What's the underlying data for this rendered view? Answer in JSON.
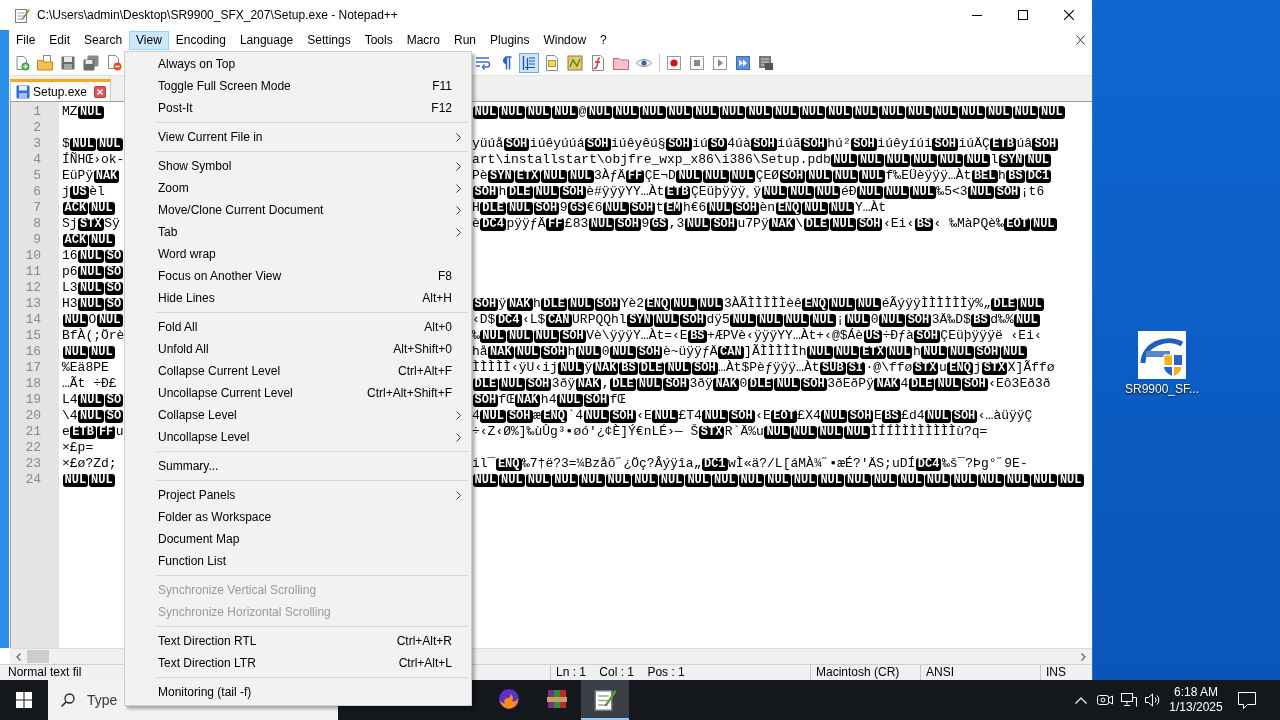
{
  "window": {
    "title": "C:\\Users\\admin\\Desktop\\SR9900_SFX_207\\Setup.exe - Notepad++"
  },
  "menus": [
    {
      "label": "File",
      "selected": false
    },
    {
      "label": "Edit",
      "selected": false
    },
    {
      "label": "Search",
      "selected": false
    },
    {
      "label": "View",
      "selected": true
    },
    {
      "label": "Encoding",
      "selected": false
    },
    {
      "label": "Language",
      "selected": false
    },
    {
      "label": "Settings",
      "selected": false
    },
    {
      "label": "Tools",
      "selected": false
    },
    {
      "label": "Macro",
      "selected": false
    },
    {
      "label": "Run",
      "selected": false
    },
    {
      "label": "Plugins",
      "selected": false
    },
    {
      "label": "Window",
      "selected": false
    },
    {
      "label": "?",
      "selected": false
    }
  ],
  "view_menu": [
    {
      "kind": "item",
      "label": "Always on Top",
      "submenu": false,
      "disabled": false
    },
    {
      "kind": "item",
      "label": "Toggle Full Screen Mode",
      "shortcut": "F11",
      "submenu": false,
      "disabled": false
    },
    {
      "kind": "item",
      "label": "Post-It",
      "shortcut": "F12",
      "submenu": false,
      "disabled": false
    },
    {
      "kind": "separator"
    },
    {
      "kind": "item",
      "label": "View Current File in",
      "submenu": true,
      "disabled": false
    },
    {
      "kind": "separator"
    },
    {
      "kind": "item",
      "label": "Show Symbol",
      "submenu": true,
      "disabled": false
    },
    {
      "kind": "item",
      "label": "Zoom",
      "submenu": true,
      "disabled": false
    },
    {
      "kind": "item",
      "label": "Move/Clone Current Document",
      "submenu": true,
      "disabled": false
    },
    {
      "kind": "item",
      "label": "Tab",
      "submenu": true,
      "disabled": false
    },
    {
      "kind": "item",
      "label": "Word wrap",
      "submenu": false,
      "disabled": false
    },
    {
      "kind": "item",
      "label": "Focus on Another View",
      "shortcut": "F8",
      "submenu": false,
      "disabled": false
    },
    {
      "kind": "item",
      "label": "Hide Lines",
      "shortcut": "Alt+H",
      "submenu": false,
      "disabled": false
    },
    {
      "kind": "separator"
    },
    {
      "kind": "item",
      "label": "Fold All",
      "shortcut": "Alt+0",
      "submenu": false,
      "disabled": false
    },
    {
      "kind": "item",
      "label": "Unfold All",
      "shortcut": "Alt+Shift+0",
      "submenu": false,
      "disabled": false
    },
    {
      "kind": "item",
      "label": "Collapse Current Level",
      "shortcut": "Ctrl+Alt+F",
      "submenu": false,
      "disabled": false
    },
    {
      "kind": "item",
      "label": "Uncollapse Current Level",
      "shortcut": "Ctrl+Alt+Shift+F",
      "submenu": false,
      "disabled": false
    },
    {
      "kind": "item",
      "label": "Collapse Level",
      "submenu": true,
      "disabled": false
    },
    {
      "kind": "item",
      "label": "Uncollapse Level",
      "submenu": true,
      "disabled": false
    },
    {
      "kind": "separator"
    },
    {
      "kind": "item",
      "label": "Summary...",
      "submenu": false,
      "disabled": false
    },
    {
      "kind": "separator"
    },
    {
      "kind": "item",
      "label": "Project Panels",
      "submenu": true,
      "disabled": false
    },
    {
      "kind": "item",
      "label": "Folder as Workspace",
      "submenu": false,
      "disabled": false
    },
    {
      "kind": "item",
      "label": "Document Map",
      "submenu": false,
      "disabled": false
    },
    {
      "kind": "item",
      "label": "Function List",
      "submenu": false,
      "disabled": false
    },
    {
      "kind": "separator"
    },
    {
      "kind": "item",
      "label": "Synchronize Vertical Scrolling",
      "submenu": false,
      "disabled": true
    },
    {
      "kind": "item",
      "label": "Synchronize Horizontal Scrolling",
      "submenu": false,
      "disabled": true
    },
    {
      "kind": "separator"
    },
    {
      "kind": "item",
      "label": "Text Direction RTL",
      "shortcut": "Ctrl+Alt+R",
      "submenu": false,
      "disabled": false
    },
    {
      "kind": "item",
      "label": "Text Direction LTR",
      "shortcut": "Ctrl+Alt+L",
      "submenu": false,
      "disabled": false
    },
    {
      "kind": "separator"
    },
    {
      "kind": "item",
      "label": "Monitoring (tail -f)",
      "submenu": false,
      "disabled": false
    }
  ],
  "toolbar": {
    "left": [
      {
        "kind": "new",
        "on": false
      },
      {
        "kind": "open",
        "on": false
      },
      {
        "kind": "save",
        "on": false
      },
      {
        "kind": "saveall",
        "on": false
      },
      {
        "kind": "close",
        "on": false
      }
    ],
    "right": [
      {
        "kind": "wrap",
        "on": false
      },
      {
        "kind": "symbols",
        "on": false
      },
      {
        "kind": "indent",
        "on": true
      },
      {
        "kind": "language",
        "on": false
      },
      {
        "kind": "map",
        "on": false
      },
      {
        "kind": "functions",
        "on": false
      },
      {
        "kind": "workspace",
        "on": false
      },
      {
        "kind": "monitor",
        "on": false
      },
      {
        "kind": "separator"
      },
      {
        "kind": "record",
        "on": false
      },
      {
        "kind": "stop",
        "on": false
      },
      {
        "kind": "play",
        "on": false
      },
      {
        "kind": "playmulti",
        "on": false
      },
      {
        "kind": "savemacro",
        "on": false
      }
    ]
  },
  "tabs": [
    {
      "label": "Setup.exe",
      "selected": true
    }
  ],
  "editor": {
    "lines": [
      {
        "number": "1",
        "left": [
          {
            "kind": "text",
            "text": "MZ"
          },
          {
            "kind": "ctrl",
            "text": "NUL"
          }
        ],
        "right": [
          {
            "kind": "ctrl",
            "text": "NUL"
          },
          {
            "kind": "ctrl",
            "text": "NUL"
          },
          {
            "kind": "ctrl",
            "text": "NUL"
          },
          {
            "kind": "ctrl",
            "text": "NUL"
          },
          {
            "kind": "text",
            "text": "@"
          },
          {
            "kind": "ctrl",
            "text": "NUL"
          },
          {
            "kind": "ctrl",
            "text": "NUL"
          },
          {
            "kind": "ctrl",
            "text": "NUL"
          },
          {
            "kind": "ctrl",
            "text": "NUL"
          },
          {
            "kind": "ctrl",
            "text": "NUL"
          },
          {
            "kind": "ctrl",
            "text": "NUL"
          },
          {
            "kind": "ctrl",
            "text": "NUL"
          },
          {
            "kind": "ctrl",
            "text": "NUL"
          },
          {
            "kind": "ctrl",
            "text": "NUL"
          },
          {
            "kind": "ctrl",
            "text": "NUL"
          },
          {
            "kind": "ctrl",
            "text": "NUL"
          },
          {
            "kind": "ctrl",
            "text": "NUL"
          },
          {
            "kind": "ctrl",
            "text": "NUL"
          },
          {
            "kind": "ctrl",
            "text": "NUL"
          },
          {
            "kind": "ctrl",
            "text": "NUL"
          },
          {
            "kind": "ctrl",
            "text": "NUL"
          },
          {
            "kind": "ctrl",
            "text": "NUL"
          },
          {
            "kind": "ctrl",
            "text": "NUL"
          }
        ]
      },
      {
        "number": "2"
      },
      {
        "number": "3",
        "left": [
          {
            "kind": "text",
            "text": "$"
          },
          {
            "kind": "ctrl",
            "text": "NUL"
          },
          {
            "kind": "ctrl",
            "text": "NUL"
          }
        ],
        "right": [
          {
            "kind": "text",
            "text": "yüúå"
          },
          {
            "kind": "ctrl",
            "text": "SOH"
          },
          {
            "kind": "text",
            "text": "iúêyúúá"
          },
          {
            "kind": "ctrl",
            "text": "SOH"
          },
          {
            "kind": "text",
            "text": "iúêyêú§"
          },
          {
            "kind": "ctrl",
            "text": "SOH"
          },
          {
            "kind": "text",
            "text": "iú"
          },
          {
            "kind": "ctrl",
            "text": "SO"
          },
          {
            "kind": "text",
            "text": "4úà"
          },
          {
            "kind": "ctrl",
            "text": "SOH"
          },
          {
            "kind": "text",
            "text": "iúã"
          },
          {
            "kind": "ctrl",
            "text": "SOH"
          },
          {
            "kind": "text",
            "text": "hú²"
          },
          {
            "kind": "ctrl",
            "text": "SOH"
          },
          {
            "kind": "text",
            "text": "iúêyíúi"
          },
          {
            "kind": "ctrl",
            "text": "SOH"
          },
          {
            "kind": "text",
            "text": "iúÄÇ"
          },
          {
            "kind": "ctrl",
            "text": "ETB"
          },
          {
            "kind": "text",
            "text": "úâ"
          },
          {
            "kind": "ctrl",
            "text": "SOH"
          }
        ]
      },
      {
        "number": "4",
        "left": [
          {
            "kind": "text",
            "text": "ÍÑHŒ›ok-"
          }
        ],
        "right": [
          {
            "kind": "text",
            "text": "art\\installstart\\objfre_wxp_x86\\i386\\Setup.pdb"
          },
          {
            "kind": "ctrl",
            "text": "NUL"
          },
          {
            "kind": "ctrl",
            "text": "NUL"
          },
          {
            "kind": "ctrl",
            "text": "NUL"
          },
          {
            "kind": "ctrl",
            "text": "NUL"
          },
          {
            "kind": "ctrl",
            "text": "NUL"
          },
          {
            "kind": "ctrl",
            "text": "NUL"
          },
          {
            "kind": "text",
            "text": "l"
          },
          {
            "kind": "ctrl",
            "text": "SYN"
          },
          {
            "kind": "ctrl",
            "text": "NUL"
          }
        ]
      },
      {
        "number": "5",
        "left": [
          {
            "kind": "text",
            "text": "EüPÿ"
          },
          {
            "kind": "ctrl",
            "text": "NAK"
          }
        ],
        "right": [
          {
            "kind": "text",
            "text": "Pè"
          },
          {
            "kind": "ctrl",
            "text": "SYN"
          },
          {
            "kind": "ctrl",
            "text": "ETX"
          },
          {
            "kind": "ctrl",
            "text": "NUL"
          },
          {
            "kind": "ctrl",
            "text": "NUL"
          },
          {
            "kind": "text",
            "text": "3ÀƒÄ"
          },
          {
            "kind": "ctrl",
            "text": "FF"
          },
          {
            "kind": "text",
            "text": "ÇE¬D"
          },
          {
            "kind": "ctrl",
            "text": "NUL"
          },
          {
            "kind": "ctrl",
            "text": "NUL"
          },
          {
            "kind": "ctrl",
            "text": "NUL"
          },
          {
            "kind": "text",
            "text": "ÇEØ"
          },
          {
            "kind": "ctrl",
            "text": "SOH"
          },
          {
            "kind": "ctrl",
            "text": "NUL"
          },
          {
            "kind": "ctrl",
            "text": "NUL"
          },
          {
            "kind": "ctrl",
            "text": "NUL"
          },
          {
            "kind": "text",
            "text": "f‰EÜèÿÿÿ…Àt"
          },
          {
            "kind": "ctrl",
            "text": "BEL"
          },
          {
            "kind": "text",
            "text": "h"
          },
          {
            "kind": "ctrl",
            "text": "BS"
          },
          {
            "kind": "ctrl",
            "text": "DC1"
          }
        ]
      },
      {
        "number": "6",
        "left": [
          {
            "kind": "text",
            "text": "j"
          },
          {
            "kind": "ctrl",
            "text": "US"
          },
          {
            "kind": "text",
            "text": "èl"
          }
        ],
        "right": [
          {
            "kind": "ctrl",
            "text": "SOH"
          },
          {
            "kind": "text",
            "text": "h"
          },
          {
            "kind": "ctrl",
            "text": "DLE"
          },
          {
            "kind": "ctrl",
            "text": "NUL"
          },
          {
            "kind": "ctrl",
            "text": "SOH"
          },
          {
            "kind": "text",
            "text": "è#ÿÿÿYY…Àt"
          },
          {
            "kind": "ctrl",
            "text": "ETB"
          },
          {
            "kind": "text",
            "text": "ÇEüþÿÿÿ¸ÿ"
          },
          {
            "kind": "ctrl",
            "text": "NUL"
          },
          {
            "kind": "ctrl",
            "text": "NUL"
          },
          {
            "kind": "ctrl",
            "text": "NUL"
          },
          {
            "kind": "text",
            "text": "éÐ"
          },
          {
            "kind": "ctrl",
            "text": "NUL"
          },
          {
            "kind": "ctrl",
            "text": "NUL"
          },
          {
            "kind": "ctrl",
            "text": "NUL"
          },
          {
            "kind": "text",
            "text": "‰5<3"
          },
          {
            "kind": "ctrl",
            "text": "NUL"
          },
          {
            "kind": "ctrl",
            "text": "SOH"
          },
          {
            "kind": "text",
            "text": "¡t6"
          }
        ]
      },
      {
        "number": "7",
        "left": [
          {
            "kind": "ctrl",
            "text": "ACK"
          },
          {
            "kind": "ctrl",
            "text": "NUL"
          }
        ],
        "right": [
          {
            "kind": "text",
            "text": "H"
          },
          {
            "kind": "ctrl",
            "text": "DLE"
          },
          {
            "kind": "ctrl",
            "text": "NUL"
          },
          {
            "kind": "ctrl",
            "text": "SOH"
          },
          {
            "kind": "text",
            "text": "9"
          },
          {
            "kind": "ctrl",
            "text": "GS"
          },
          {
            "kind": "text",
            "text": "€6"
          },
          {
            "kind": "ctrl",
            "text": "NUL"
          },
          {
            "kind": "ctrl",
            "text": "SOH"
          },
          {
            "kind": "text",
            "text": "t"
          },
          {
            "kind": "ctrl",
            "text": "EM"
          },
          {
            "kind": "text",
            "text": "h€6"
          },
          {
            "kind": "ctrl",
            "text": "NUL"
          },
          {
            "kind": "ctrl",
            "text": "SOH"
          },
          {
            "kind": "text",
            "text": "èn"
          },
          {
            "kind": "ctrl",
            "text": "ENQ"
          },
          {
            "kind": "ctrl",
            "text": "NUL"
          },
          {
            "kind": "ctrl",
            "text": "NUL"
          },
          {
            "kind": "text",
            "text": "Y…Àt"
          }
        ]
      },
      {
        "number": "8",
        "left": [
          {
            "kind": "text",
            "text": "Sj"
          },
          {
            "kind": "ctrl",
            "text": "STX"
          },
          {
            "kind": "text",
            "text": "Sÿ"
          }
        ],
        "right": [
          {
            "kind": "text",
            "text": "è"
          },
          {
            "kind": "ctrl",
            "text": "DC4"
          },
          {
            "kind": "text",
            "text": "pÿÿƒÄ"
          },
          {
            "kind": "ctrl",
            "text": "FF"
          },
          {
            "kind": "text",
            "text": "£83"
          },
          {
            "kind": "ctrl",
            "text": "NUL"
          },
          {
            "kind": "ctrl",
            "text": "SOH"
          },
          {
            "kind": "text",
            "text": "9"
          },
          {
            "kind": "ctrl",
            "text": "GS"
          },
          {
            "kind": "text",
            "text": ",3"
          },
          {
            "kind": "ctrl",
            "text": "NUL"
          },
          {
            "kind": "ctrl",
            "text": "SOH"
          },
          {
            "kind": "text",
            "text": "u7Pÿ"
          },
          {
            "kind": "ctrl",
            "text": "NAK"
          },
          {
            "kind": "text",
            "text": "\\"
          },
          {
            "kind": "ctrl",
            "text": "DLE"
          },
          {
            "kind": "ctrl",
            "text": "NUL"
          },
          {
            "kind": "ctrl",
            "text": "SOH"
          },
          {
            "kind": "text",
            "text": "‹Ei‹"
          },
          {
            "kind": "ctrl",
            "text": "BS"
          },
          {
            "kind": "text",
            "text": "‹ ‰MàPQè‰"
          },
          {
            "kind": "ctrl",
            "text": "EOT"
          },
          {
            "kind": "ctrl",
            "text": "NUL"
          }
        ]
      },
      {
        "number": "9",
        "left": [
          {
            "kind": "ctrl",
            "text": "ACK"
          },
          {
            "kind": "ctrl",
            "text": "NUL"
          }
        ]
      },
      {
        "number": "10",
        "left": [
          {
            "kind": "text",
            "text": "16"
          },
          {
            "kind": "ctrl",
            "text": "NUL"
          },
          {
            "kind": "ctrl",
            "text": "SO"
          }
        ]
      },
      {
        "number": "11",
        "left": [
          {
            "kind": "text",
            "text": "p6"
          },
          {
            "kind": "ctrl",
            "text": "NUL"
          },
          {
            "kind": "ctrl",
            "text": "SO"
          }
        ]
      },
      {
        "number": "12",
        "left": [
          {
            "kind": "text",
            "text": "L3"
          },
          {
            "kind": "ctrl",
            "text": "NUL"
          },
          {
            "kind": "ctrl",
            "text": "SO"
          }
        ]
      },
      {
        "number": "13",
        "left": [
          {
            "kind": "text",
            "text": "H3"
          },
          {
            "kind": "ctrl",
            "text": "NUL"
          },
          {
            "kind": "ctrl",
            "text": "SO"
          }
        ],
        "right": [
          {
            "kind": "ctrl",
            "text": "SOH"
          },
          {
            "kind": "text",
            "text": "ÿ"
          },
          {
            "kind": "ctrl",
            "text": "NAK"
          },
          {
            "kind": "text",
            "text": "h"
          },
          {
            "kind": "ctrl",
            "text": "DLE"
          },
          {
            "kind": "ctrl",
            "text": "NUL"
          },
          {
            "kind": "ctrl",
            "text": "SOH"
          },
          {
            "kind": "text",
            "text": "Yè2"
          },
          {
            "kind": "ctrl",
            "text": "ENQ"
          },
          {
            "kind": "ctrl",
            "text": "NUL"
          },
          {
            "kind": "ctrl",
            "text": "NUL"
          },
          {
            "kind": "text",
            "text": "3ÀÃÌÌÌÌÌèê"
          },
          {
            "kind": "ctrl",
            "text": "ENQ"
          },
          {
            "kind": "ctrl",
            "text": "NUL"
          },
          {
            "kind": "ctrl",
            "text": "NUL"
          },
          {
            "kind": "text",
            "text": "éÃýÿÿÌÌÌÌÌÌÿ%„"
          },
          {
            "kind": "ctrl",
            "text": "DLE"
          },
          {
            "kind": "ctrl",
            "text": "NUL"
          }
        ]
      },
      {
        "number": "14",
        "left": [
          {
            "kind": "ctrl",
            "text": "NUL"
          },
          {
            "kind": "text",
            "text": "O"
          },
          {
            "kind": "ctrl",
            "text": "NUL"
          }
        ],
        "right": [
          {
            "kind": "text",
            "text": "‹D$"
          },
          {
            "kind": "ctrl",
            "text": "DC4"
          },
          {
            "kind": "text",
            "text": "‹L$"
          },
          {
            "kind": "ctrl",
            "text": "CAN"
          },
          {
            "kind": "text",
            "text": "URPQQhl"
          },
          {
            "kind": "ctrl",
            "text": "SYN"
          },
          {
            "kind": "ctrl",
            "text": "NUL"
          },
          {
            "kind": "ctrl",
            "text": "SOH"
          },
          {
            "kind": "text",
            "text": "dÿ5"
          },
          {
            "kind": "ctrl",
            "text": "NUL"
          },
          {
            "kind": "ctrl",
            "text": "NUL"
          },
          {
            "kind": "ctrl",
            "text": "NUL"
          },
          {
            "kind": "ctrl",
            "text": "NUL"
          },
          {
            "kind": "text",
            "text": "¡"
          },
          {
            "kind": "ctrl",
            "text": "NUL"
          },
          {
            "kind": "text",
            "text": "0"
          },
          {
            "kind": "ctrl",
            "text": "NUL"
          },
          {
            "kind": "ctrl",
            "text": "SOH"
          },
          {
            "kind": "text",
            "text": "3Ä‰D$"
          },
          {
            "kind": "ctrl",
            "text": "BS"
          },
          {
            "kind": "text",
            "text": "d‰%"
          },
          {
            "kind": "ctrl",
            "text": "NUL"
          }
        ]
      },
      {
        "number": "15",
        "left": [
          {
            "kind": "text",
            "text": "BfÀ(;Örè"
          }
        ],
        "right": [
          {
            "kind": "text",
            "text": "‰"
          },
          {
            "kind": "ctrl",
            "text": "NUL"
          },
          {
            "kind": "ctrl",
            "text": "NUL"
          },
          {
            "kind": "ctrl",
            "text": "NUL"
          },
          {
            "kind": "ctrl",
            "text": "SOH"
          },
          {
            "kind": "text",
            "text": "Vè\\ÿÿÿY…Àt=‹E"
          },
          {
            "kind": "ctrl",
            "text": "BS"
          },
          {
            "kind": "text",
            "text": "+ÆPVè‹ÿÿÿYY…Àt+‹@$Áè"
          },
          {
            "kind": "ctrl",
            "text": "US"
          },
          {
            "kind": "text",
            "text": "÷Ðƒà"
          },
          {
            "kind": "ctrl",
            "text": "SOH"
          },
          {
            "kind": "text",
            "text": "ÇEüþÿÿÿë ‹Ei‹"
          }
        ]
      },
      {
        "number": "16",
        "left": [
          {
            "kind": "ctrl",
            "text": "NUL"
          },
          {
            "kind": "ctrl",
            "text": "NUL"
          }
        ],
        "right": [
          {
            "kind": "text",
            "text": "hå"
          },
          {
            "kind": "ctrl",
            "text": "NAK"
          },
          {
            "kind": "ctrl",
            "text": "NUL"
          },
          {
            "kind": "ctrl",
            "text": "SOH"
          },
          {
            "kind": "text",
            "text": "h"
          },
          {
            "kind": "ctrl",
            "text": "NUL"
          },
          {
            "kind": "text",
            "text": "0"
          },
          {
            "kind": "ctrl",
            "text": "NUL"
          },
          {
            "kind": "ctrl",
            "text": "SOH"
          },
          {
            "kind": "text",
            "text": "è~üÿÿƒÄ"
          },
          {
            "kind": "ctrl",
            "text": "CAN"
          },
          {
            "kind": "text",
            "text": "]ÃÌÌÌÌÌh"
          },
          {
            "kind": "ctrl",
            "text": "NUL"
          },
          {
            "kind": "ctrl",
            "text": "NUL"
          },
          {
            "kind": "ctrl",
            "text": "ETX"
          },
          {
            "kind": "ctrl",
            "text": "NUL"
          },
          {
            "kind": "text",
            "text": "h"
          },
          {
            "kind": "ctrl",
            "text": "NUL"
          },
          {
            "kind": "ctrl",
            "text": "NUL"
          },
          {
            "kind": "ctrl",
            "text": "SOH"
          },
          {
            "kind": "ctrl",
            "text": "NUL"
          }
        ]
      },
      {
        "number": "17",
        "left": [
          {
            "kind": "text",
            "text": "%Eä8PE"
          }
        ],
        "right": [
          {
            "kind": "text",
            "text": "ÌÌÌÌÌ‹ÿU‹ij"
          },
          {
            "kind": "ctrl",
            "text": "NUL"
          },
          {
            "kind": "text",
            "text": "ÿ"
          },
          {
            "kind": "ctrl",
            "text": "NAK"
          },
          {
            "kind": "ctrl",
            "text": "BS"
          },
          {
            "kind": "ctrl",
            "text": "DLE"
          },
          {
            "kind": "ctrl",
            "text": "NUL"
          },
          {
            "kind": "ctrl",
            "text": "SOH"
          },
          {
            "kind": "text",
            "text": "…Àt$Pèƒÿÿÿ…Àt"
          },
          {
            "kind": "ctrl",
            "text": "SUB"
          },
          {
            "kind": "ctrl",
            "text": "SI"
          },
          {
            "kind": "text",
            "text": "·@\\ffø"
          },
          {
            "kind": "ctrl",
            "text": "STX"
          },
          {
            "kind": "text",
            "text": "u"
          },
          {
            "kind": "ctrl",
            "text": "ENQ"
          },
          {
            "kind": "text",
            "text": "j"
          },
          {
            "kind": "ctrl",
            "text": "STX"
          },
          {
            "kind": "text",
            "text": "X]Ãffø"
          }
        ]
      },
      {
        "number": "18",
        "left": [
          {
            "kind": "text",
            "text": "…Ãt ÷Ð£"
          }
        ],
        "right": [
          {
            "kind": "ctrl",
            "text": "DLE"
          },
          {
            "kind": "ctrl",
            "text": "NUL"
          },
          {
            "kind": "ctrl",
            "text": "SOH"
          },
          {
            "kind": "text",
            "text": "3ðÿ"
          },
          {
            "kind": "ctrl",
            "text": "NAK"
          },
          {
            "kind": "text",
            "text": ","
          },
          {
            "kind": "ctrl",
            "text": "DLE"
          },
          {
            "kind": "ctrl",
            "text": "NUL"
          },
          {
            "kind": "ctrl",
            "text": "SOH"
          },
          {
            "kind": "text",
            "text": "3ðÿ"
          },
          {
            "kind": "ctrl",
            "text": "NAK"
          },
          {
            "kind": "text",
            "text": "0"
          },
          {
            "kind": "ctrl",
            "text": "DLE"
          },
          {
            "kind": "ctrl",
            "text": "NUL"
          },
          {
            "kind": "ctrl",
            "text": "SOH"
          },
          {
            "kind": "text",
            "text": "3ðEðPÿ"
          },
          {
            "kind": "ctrl",
            "text": "NAK"
          },
          {
            "kind": "text",
            "text": "4"
          },
          {
            "kind": "ctrl",
            "text": "DLE"
          },
          {
            "kind": "ctrl",
            "text": "NUL"
          },
          {
            "kind": "ctrl",
            "text": "SOH"
          },
          {
            "kind": "text",
            "text": "‹Eô3Eð3ð"
          }
        ]
      },
      {
        "number": "19",
        "left": [
          {
            "kind": "text",
            "text": "L4"
          },
          {
            "kind": "ctrl",
            "text": "NUL"
          },
          {
            "kind": "ctrl",
            "text": "SO"
          }
        ],
        "right": [
          {
            "kind": "ctrl",
            "text": "SOH"
          },
          {
            "kind": "text",
            "text": "fŒ"
          },
          {
            "kind": "ctrl",
            "text": "NAK"
          },
          {
            "kind": "text",
            "text": "h4"
          },
          {
            "kind": "ctrl",
            "text": "NUL"
          },
          {
            "kind": "ctrl",
            "text": "SOH"
          },
          {
            "kind": "text",
            "text": "fŒ"
          }
        ]
      },
      {
        "number": "20",
        "left": [
          {
            "kind": "text",
            "text": "\\4"
          },
          {
            "kind": "ctrl",
            "text": "NUL"
          },
          {
            "kind": "ctrl",
            "text": "SO"
          }
        ],
        "right": [
          {
            "kind": "text",
            "text": "4"
          },
          {
            "kind": "ctrl",
            "text": "NUL"
          },
          {
            "kind": "ctrl",
            "text": "SOH"
          },
          {
            "kind": "text",
            "text": "æ"
          },
          {
            "kind": "ctrl",
            "text": "ENQ"
          },
          {
            "kind": "text",
            "text": "`4"
          },
          {
            "kind": "ctrl",
            "text": "NUL"
          },
          {
            "kind": "ctrl",
            "text": "SOH"
          },
          {
            "kind": "text",
            "text": "‹E"
          },
          {
            "kind": "ctrl",
            "text": "NUL"
          },
          {
            "kind": "text",
            "text": "£T4"
          },
          {
            "kind": "ctrl",
            "text": "NUL"
          },
          {
            "kind": "ctrl",
            "text": "SOH"
          },
          {
            "kind": "text",
            "text": "‹E"
          },
          {
            "kind": "ctrl",
            "text": "EOT"
          },
          {
            "kind": "text",
            "text": "£X4"
          },
          {
            "kind": "ctrl",
            "text": "NUL"
          },
          {
            "kind": "ctrl",
            "text": "SOH"
          },
          {
            "kind": "text",
            "text": "E"
          },
          {
            "kind": "ctrl",
            "text": "BS"
          },
          {
            "kind": "text",
            "text": "£d4"
          },
          {
            "kind": "ctrl",
            "text": "NUL"
          },
          {
            "kind": "ctrl",
            "text": "SOH"
          },
          {
            "kind": "text",
            "text": "‹…àüÿÿÇ"
          }
        ]
      },
      {
        "number": "21",
        "left": [
          {
            "kind": "text",
            "text": "e"
          },
          {
            "kind": "ctrl",
            "text": "ETB"
          },
          {
            "kind": "ctrl",
            "text": "FF"
          },
          {
            "kind": "text",
            "text": "u"
          }
        ],
        "right": [
          {
            "kind": "text",
            "text": "÷‹Z‹Ø%]‰ùÛg³▪øó'¿¢È]Ý€nLÉ›— Š"
          },
          {
            "kind": "ctrl",
            "text": "STX"
          },
          {
            "kind": "text",
            "text": "R`Ä%u"
          },
          {
            "kind": "ctrl",
            "text": "NUL"
          },
          {
            "kind": "ctrl",
            "text": "NUL"
          },
          {
            "kind": "ctrl",
            "text": "NUL"
          },
          {
            "kind": "ctrl",
            "text": "NUL"
          },
          {
            "kind": "text",
            "text": "ÌÍÍÌÌÌÌÌÌÌÌù?q="
          }
        ]
      },
      {
        "number": "22",
        "left": [
          {
            "kind": "text",
            "text": "×£p="
          }
        ]
      },
      {
        "number": "23",
        "left": [
          {
            "kind": "text",
            "text": "×£ø?Zd;"
          }
        ],
        "right": [
          {
            "kind": "text",
            "text": "il¯"
          },
          {
            "kind": "ctrl",
            "text": "ENQ"
          },
          {
            "kind": "text",
            "text": "‰7†ë?3=¼Bzåõ˝¿Öç?Âýÿîa„"
          },
          {
            "kind": "ctrl",
            "text": "DC1"
          },
          {
            "kind": "text",
            "text": "wÌ«ä?/L[áMÀ¾˝▪æÉ?'ÄS;uDÍ"
          },
          {
            "kind": "ctrl",
            "text": "DC4"
          },
          {
            "kind": "text",
            "text": "‰š¯?Þg°˝9E-"
          }
        ]
      },
      {
        "number": "24",
        "left": [
          {
            "kind": "ctrl",
            "text": "NUL"
          },
          {
            "kind": "ctrl",
            "text": "NUL"
          }
        ],
        "right": [
          {
            "kind": "ctrl",
            "text": "NUL"
          },
          {
            "kind": "ctrl",
            "text": "NUL"
          },
          {
            "kind": "ctrl",
            "text": "NUL"
          },
          {
            "kind": "ctrl",
            "text": "NUL"
          },
          {
            "kind": "ctrl",
            "text": "NUL"
          },
          {
            "kind": "ctrl",
            "text": "NUL"
          },
          {
            "kind": "ctrl",
            "text": "NUL"
          },
          {
            "kind": "ctrl",
            "text": "NUL"
          },
          {
            "kind": "ctrl",
            "text": "NUL"
          },
          {
            "kind": "ctrl",
            "text": "NUL"
          },
          {
            "kind": "ctrl",
            "text": "NUL"
          },
          {
            "kind": "ctrl",
            "text": "NUL"
          },
          {
            "kind": "ctrl",
            "text": "NUL"
          },
          {
            "kind": "ctrl",
            "text": "NUL"
          },
          {
            "kind": "ctrl",
            "text": "NUL"
          },
          {
            "kind": "ctrl",
            "text": "NUL"
          },
          {
            "kind": "ctrl",
            "text": "NUL"
          },
          {
            "kind": "ctrl",
            "text": "NUL"
          },
          {
            "kind": "ctrl",
            "text": "NUL"
          },
          {
            "kind": "ctrl",
            "text": "NUL"
          },
          {
            "kind": "ctrl",
            "text": "NUL"
          },
          {
            "kind": "ctrl",
            "text": "NUL"
          },
          {
            "kind": "ctrl",
            "text": "NUL"
          }
        ]
      }
    ]
  },
  "status_bar": [
    "Normal text fil",
    "Ln : 1    Col : 1    Pos : 1",
    "Macintosh (CR)",
    "ANSI",
    "INS"
  ],
  "taskbar": {
    "search": {
      "placeholder": "Type"
    },
    "apps": [
      {
        "kind": "browser",
        "selected": false
      },
      {
        "kind": "archive",
        "selected": false
      },
      {
        "kind": "notepad",
        "selected": true
      }
    ],
    "clock": {
      "time": "6:18 AM",
      "date": "1/13/2025"
    }
  },
  "desktop": {
    "icons": [
      {
        "label": "SR9900_SF..."
      }
    ]
  }
}
